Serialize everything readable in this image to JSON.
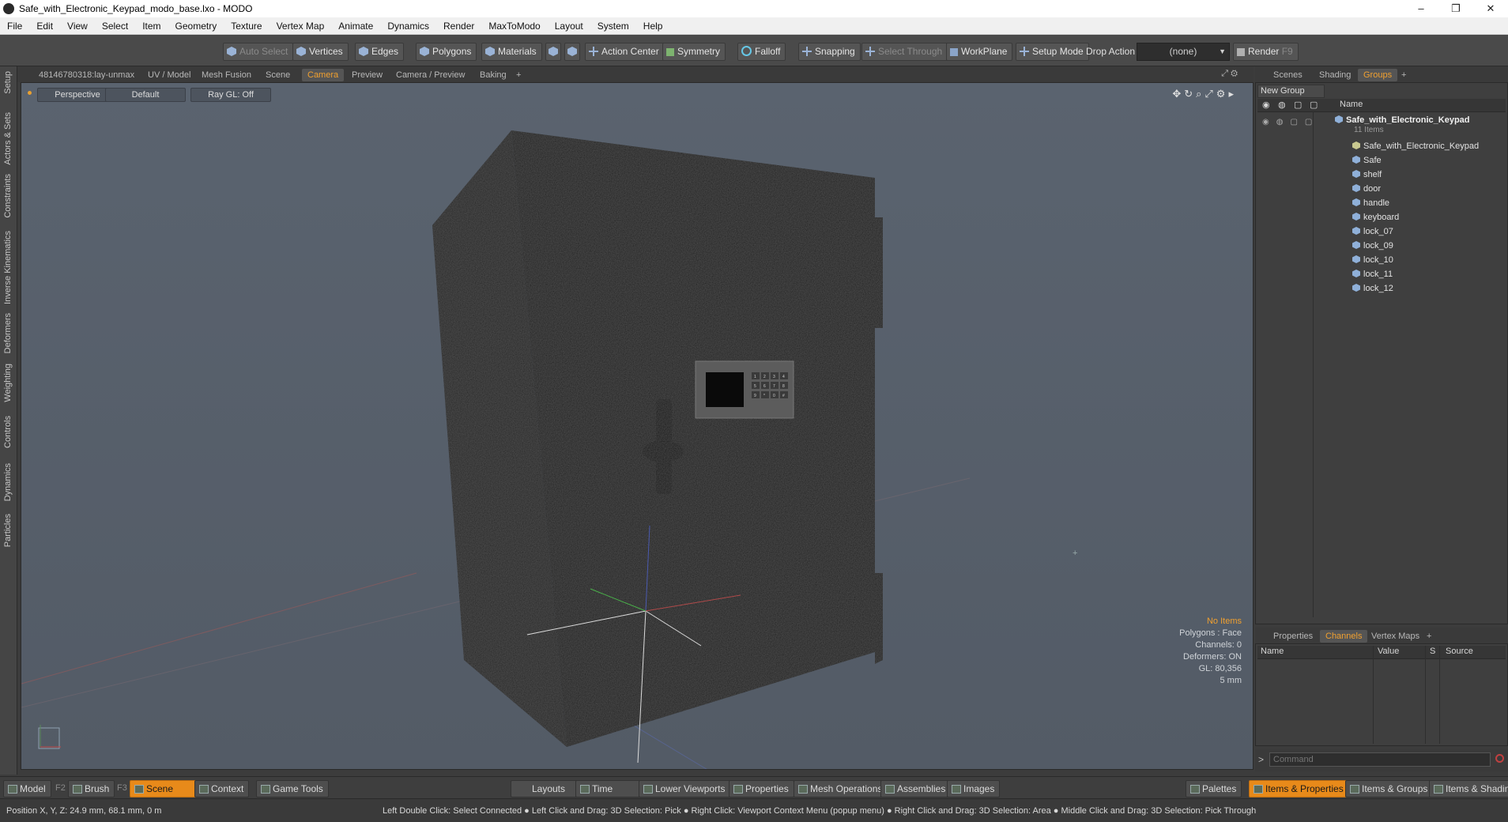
{
  "window": {
    "title": "Safe_with_Electronic_Keypad_modo_base.lxo - MODO"
  },
  "menu": [
    "File",
    "Edit",
    "View",
    "Select",
    "Item",
    "Geometry",
    "Texture",
    "Vertex Map",
    "Animate",
    "Dynamics",
    "Render",
    "MaxToModo",
    "Layout",
    "System",
    "Help"
  ],
  "toolbar": {
    "auto_select": "Auto Select",
    "vertices": "Vertices",
    "edges": "Edges",
    "polygons": "Polygons",
    "materials": "Materials",
    "action_center": "Action Center",
    "symmetry": "Symmetry",
    "falloff": "Falloff",
    "snapping": "Snapping",
    "select_through": "Select Through",
    "workplane": "WorkPlane",
    "setup_mode": "Setup Mode",
    "drop_action": "Drop Action",
    "drop_value": "(none)",
    "render": "Render",
    "render_key": "F9"
  },
  "left_tabs": [
    "Setup",
    "Actors & Sets",
    "Constraints",
    "Inverse Kinematics",
    "Deformers",
    "Weighting",
    "Controls",
    "Dynamics",
    "Particles"
  ],
  "viewport_tabs": [
    "48146780318:lay-unmax",
    "UV / Model",
    "Mesh Fusion",
    "Scene",
    "Camera",
    "Preview",
    "Camera / Preview",
    "Baking",
    "+"
  ],
  "viewport": {
    "view": "Perspective",
    "shading": "Default",
    "raygl": "Ray GL: Off",
    "stats": [
      "No Items",
      "Polygons : Face",
      "Channels: 0",
      "Deformers: ON",
      "GL: 80,356",
      "5 mm"
    ],
    "keypad_keys": [
      "1",
      "2",
      "3",
      "4",
      "5",
      "6",
      "7",
      "8",
      "9",
      "*",
      "0",
      "#"
    ]
  },
  "right_tabs": [
    "Scenes",
    "Shading",
    "Groups",
    "+"
  ],
  "groups": {
    "new_group": "New Group",
    "name_col": "Name",
    "root": "Safe_with_Electronic_Keypad",
    "root_count": "11 Items",
    "items": [
      "Safe_with_Electronic_Keypad",
      "Safe",
      "shelf",
      "door",
      "handle",
      "keyboard",
      "lock_07",
      "lock_09",
      "lock_10",
      "lock_11",
      "lock_12"
    ]
  },
  "channel_tabs": [
    "Properties",
    "Channels",
    "Vertex Maps",
    "+"
  ],
  "channels": {
    "cols": [
      "Name",
      "Value",
      "S",
      "Source"
    ]
  },
  "command": {
    "placeholder": "Command"
  },
  "bottom": {
    "left": [
      {
        "label": "Model",
        "key": "F2"
      },
      {
        "label": "Brush",
        "key": "F3"
      },
      {
        "label": "Scene",
        "key": "F4"
      },
      {
        "label": "Context",
        "key": ""
      },
      {
        "label": "Game Tools",
        "key": ""
      }
    ],
    "center": [
      "Layouts",
      "Time",
      "Lower Viewports",
      "Properties",
      "Mesh Operations",
      "Assemblies",
      "Images"
    ],
    "right": [
      "Palettes",
      "Items & Properties",
      "Items & Groups",
      "Items & Shading"
    ]
  },
  "status": {
    "position": "Position X, Y, Z:   24.9 mm, 68.1 mm, 0 m",
    "hint": "Left Double Click: Select Connected ● Left Click and Drag: 3D Selection: Pick ● Right Click: Viewport Context Menu (popup menu) ● Right Click and Drag: 3D Selection: Area ● Middle Click and Drag: 3D Selection: Pick Through"
  }
}
